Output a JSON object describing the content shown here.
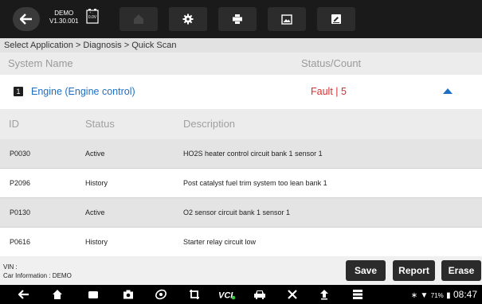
{
  "topbar": {
    "device": "DEMO",
    "version": "V1.30.001",
    "battery_voltage": "0.0V",
    "icons": [
      "back-icon",
      "home-icon",
      "gear-icon",
      "print-icon",
      "image-icon",
      "edit-icon"
    ]
  },
  "breadcrumb": "Select Application > Diagnosis > Quick Scan",
  "system_header": {
    "name": "System Name",
    "status": "Status/Count"
  },
  "system": {
    "number": "1",
    "name": "Engine (Engine control)",
    "status": "Fault | 5"
  },
  "table": {
    "headers": {
      "id": "ID",
      "status": "Status",
      "description": "Description"
    },
    "rows": [
      {
        "id": "P0030",
        "status": "Active",
        "description": "HO2S heater control circuit bank 1  sensor 1"
      },
      {
        "id": "P2096",
        "status": "History",
        "description": "Post catalyst fuel trim system too lean bank 1"
      },
      {
        "id": "P0130",
        "status": "Active",
        "description": "O2 sensor circuit bank 1 sensor 1"
      },
      {
        "id": "P0616",
        "status": "History",
        "description": "Starter relay circuit low"
      }
    ]
  },
  "footer": {
    "vin": "VIN :",
    "car_info": "Car Information : DEMO",
    "save": "Save",
    "report": "Report",
    "erase": "Erase"
  },
  "statusbar": {
    "battery": "71%",
    "time": "08:47"
  },
  "colors": {
    "accent_blue": "#1e6fc4",
    "fault_red": "#d32f2f",
    "topbar": "#1a1a1a"
  }
}
